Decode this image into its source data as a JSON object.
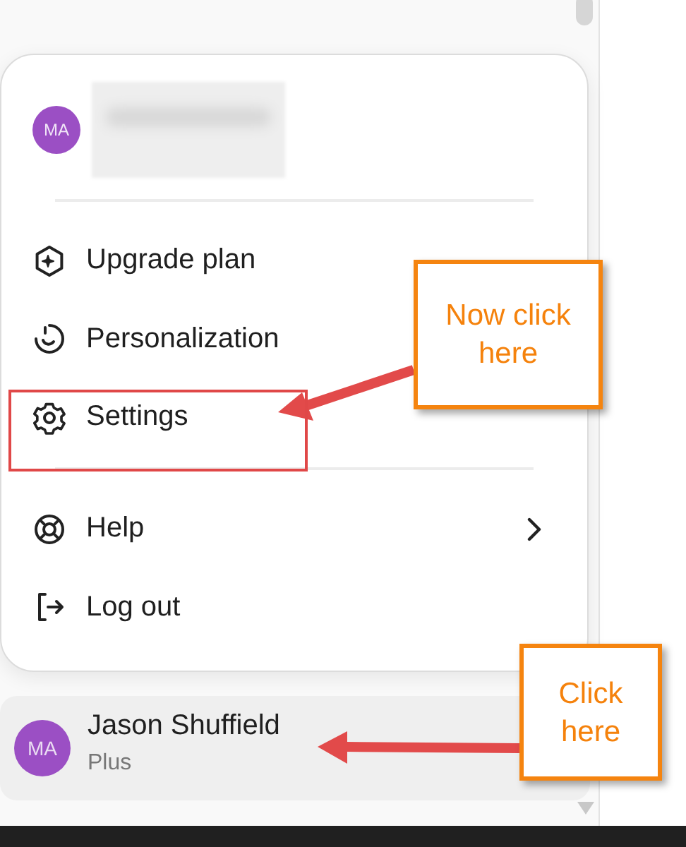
{
  "account_menu": {
    "avatar_initials": "MA",
    "redacted": true,
    "sections": [
      {
        "items": [
          {
            "label": "Upgrade plan",
            "has_submenu": false
          },
          {
            "label": "Personalization",
            "has_submenu": false
          },
          {
            "label": "Settings",
            "has_submenu": false
          }
        ]
      },
      {
        "items": [
          {
            "label": "Help",
            "has_submenu": true
          },
          {
            "label": "Log out",
            "has_submenu": false
          }
        ]
      }
    ]
  },
  "user": {
    "avatar_initials": "MA",
    "name": "Jason Shuffield",
    "plan": "Plus"
  },
  "annotations": [
    {
      "kind": "highlight"
    },
    {
      "kind": "callout",
      "text": "Now click here"
    },
    {
      "kind": "callout",
      "text": "Click here"
    }
  ]
}
